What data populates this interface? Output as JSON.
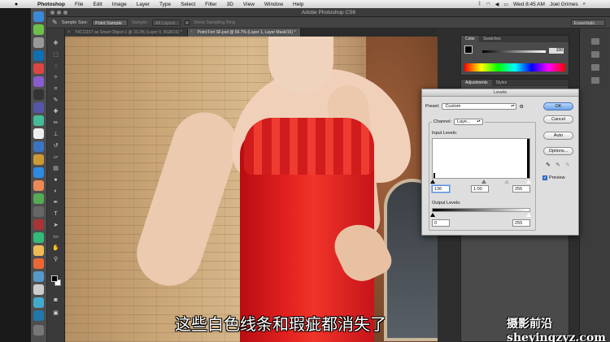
{
  "menubar": {
    "apple": "",
    "items": [
      "Photoshop",
      "File",
      "Edit",
      "Image",
      "Layer",
      "Type",
      "Select",
      "Filter",
      "3D",
      "View",
      "Window",
      "Help"
    ],
    "clock": "Wed 8:45 AM",
    "user": "Joel Grimes"
  },
  "window": {
    "title": "Adobe Photoshop CS6"
  },
  "options": {
    "sample_size_label": "Sample Size:",
    "sample_size_value": "Point Sample",
    "sample_label": "Sample:",
    "sample_value": "All Layers",
    "show_ring": "Show Sampling Ring",
    "workspace": "Essentials"
  },
  "tabs": [
    {
      "label": "T4C11157 as Smart Object-1 @ 33.3% (Layer 0, RGB/16) *"
    },
    {
      "label": "Point Fort SF.psd @ 66.7% (Layer 1, Layer Mask/16) *"
    }
  ],
  "panels": {
    "color_tabs": [
      "Color",
      "Swatches"
    ],
    "k_value": "100",
    "adj_tabs": [
      "Adjustments",
      "Styles"
    ]
  },
  "levels": {
    "title": "Levels",
    "preset_label": "Preset:",
    "preset_value": "Custom",
    "channel_label": "Channel:",
    "channel_value": "Laye...",
    "input_label": "Input Levels:",
    "input_black": "136",
    "input_gamma": "1.00",
    "input_white": "255",
    "output_label": "Output Levels:",
    "output_black": "0",
    "output_white": "255",
    "buttons": {
      "ok": "OK",
      "cancel": "Cancel",
      "auto": "Auto",
      "options": "Options..."
    },
    "preview_label": "Preview"
  },
  "subtitle": "这些白色线条和瑕疵都消失了",
  "watermark": "摄影前沿 sheyingzyz.com"
}
